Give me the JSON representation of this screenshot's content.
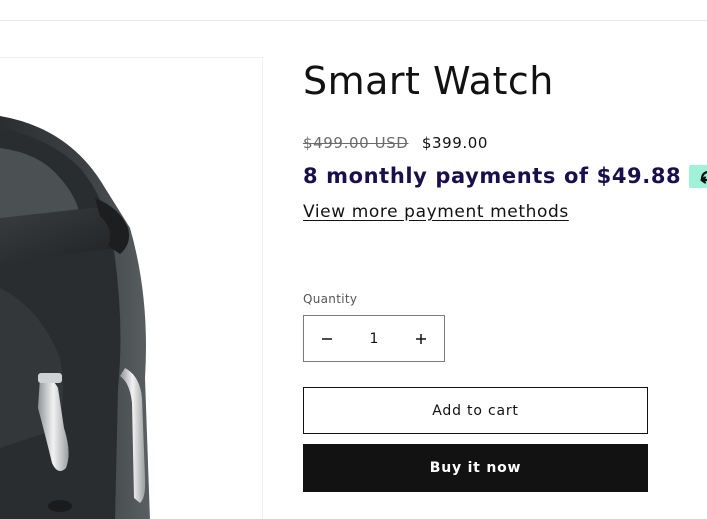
{
  "product": {
    "title": "Smart Watch",
    "price_compare": "$499.00 USD",
    "price_sale": "$399.00",
    "installments_text": "8 monthly payments of $49.88",
    "installments_badge_icon": "affirm-logo-icon",
    "view_more_payments_label": "View more payment methods",
    "quantity": {
      "label": "Quantity",
      "value": "1",
      "decrease_icon": "minus-icon",
      "increase_icon": "plus-icon"
    },
    "add_to_cart_label": "Add to cart",
    "buy_now_label": "Buy it now"
  },
  "colors": {
    "text": "#121212",
    "installments_text": "#1a0f4a",
    "badge_bg": "#9ff2d8",
    "buy_button_bg": "#121212",
    "buy_button_text": "#ffffff"
  }
}
